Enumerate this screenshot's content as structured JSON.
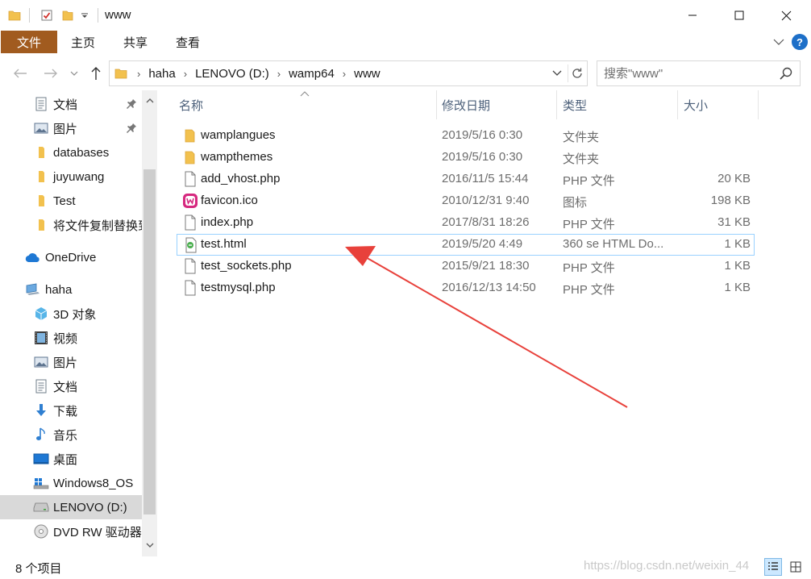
{
  "window": {
    "title": "www",
    "minimize_icon": "minimize-icon",
    "maximize_icon": "maximize-icon",
    "close_icon": "close-icon"
  },
  "quick_access": {
    "icons": [
      "folder-icon",
      "properties-checkmark-icon",
      "new-folder-icon",
      "customize-dropdown-icon"
    ]
  },
  "ribbon": {
    "file_tab": "文件",
    "tabs": [
      "主页",
      "共享",
      "查看"
    ],
    "accent_color": "#a15b1f",
    "help_label": "?"
  },
  "address_bar": {
    "segments": [
      "haha",
      "LENOVO (D:)",
      "wamp64",
      "www"
    ]
  },
  "search": {
    "placeholder": "搜索\"www\""
  },
  "nav_pane": {
    "items": [
      {
        "label": "文档",
        "icon": "documents-icon",
        "pinned": true
      },
      {
        "label": "图片",
        "icon": "pictures-icon",
        "pinned": true
      },
      {
        "label": "databases",
        "icon": "folder-icon",
        "pinned": false
      },
      {
        "label": "juyuwang",
        "icon": "folder-icon",
        "pinned": false
      },
      {
        "label": "Test",
        "icon": "folder-icon",
        "pinned": false
      },
      {
        "label": "将文件复制替换到",
        "icon": "folder-icon",
        "pinned": false
      },
      {
        "label": "OneDrive",
        "icon": "onedrive-cloud-icon",
        "pinned": false
      },
      {
        "label": "haha",
        "icon": "this-pc-icon",
        "pinned": false
      },
      {
        "label": "3D 对象",
        "icon": "3d-objects-icon",
        "pinned": false
      },
      {
        "label": "视频",
        "icon": "videos-icon",
        "pinned": false
      },
      {
        "label": "图片",
        "icon": "pictures-icon",
        "pinned": false
      },
      {
        "label": "文档",
        "icon": "documents-icon",
        "pinned": false
      },
      {
        "label": "下载",
        "icon": "downloads-icon",
        "pinned": false
      },
      {
        "label": "音乐",
        "icon": "music-icon",
        "pinned": false
      },
      {
        "label": "桌面",
        "icon": "desktop-icon",
        "pinned": false
      },
      {
        "label": "Windows8_OS",
        "icon": "windows-drive-icon",
        "pinned": false
      },
      {
        "label": "LENOVO (D:)",
        "icon": "drive-icon",
        "pinned": false,
        "selected": true
      },
      {
        "label": "DVD RW 驱动器",
        "icon": "dvd-drive-icon",
        "pinned": false
      }
    ]
  },
  "columns": {
    "name": "名称",
    "modified": "修改日期",
    "type": "类型",
    "size": "大小"
  },
  "files": [
    {
      "name": "wamplangues",
      "modified": "2019/5/16 0:30",
      "type": "文件夹",
      "size": "",
      "icon": "folder-icon"
    },
    {
      "name": "wampthemes",
      "modified": "2019/5/16 0:30",
      "type": "文件夹",
      "size": "",
      "icon": "folder-icon"
    },
    {
      "name": "add_vhost.php",
      "modified": "2016/11/5 15:44",
      "type": "PHP 文件",
      "size": "20 KB",
      "icon": "file-icon"
    },
    {
      "name": "favicon.ico",
      "modified": "2010/12/31 9:40",
      "type": "图标",
      "size": "198 KB",
      "icon": "wamp-favicon-icon"
    },
    {
      "name": "index.php",
      "modified": "2017/8/31 18:26",
      "type": "PHP 文件",
      "size": "31 KB",
      "icon": "file-icon"
    },
    {
      "name": "test.html",
      "modified": "2019/5/20 4:49",
      "type": "360 se HTML Do...",
      "size": "1 KB",
      "icon": "html-file-icon",
      "selected": true
    },
    {
      "name": "test_sockets.php",
      "modified": "2015/9/21 18:30",
      "type": "PHP 文件",
      "size": "1 KB",
      "icon": "file-icon"
    },
    {
      "name": "testmysql.php",
      "modified": "2016/12/13 14:50",
      "type": "PHP 文件",
      "size": "1 KB",
      "icon": "file-icon"
    }
  ],
  "status_bar": {
    "item_count": "8 个项目",
    "watermark": "https://blog.csdn.net/weixin_44"
  },
  "annotation": {
    "arrow_color": "#e8413b"
  }
}
